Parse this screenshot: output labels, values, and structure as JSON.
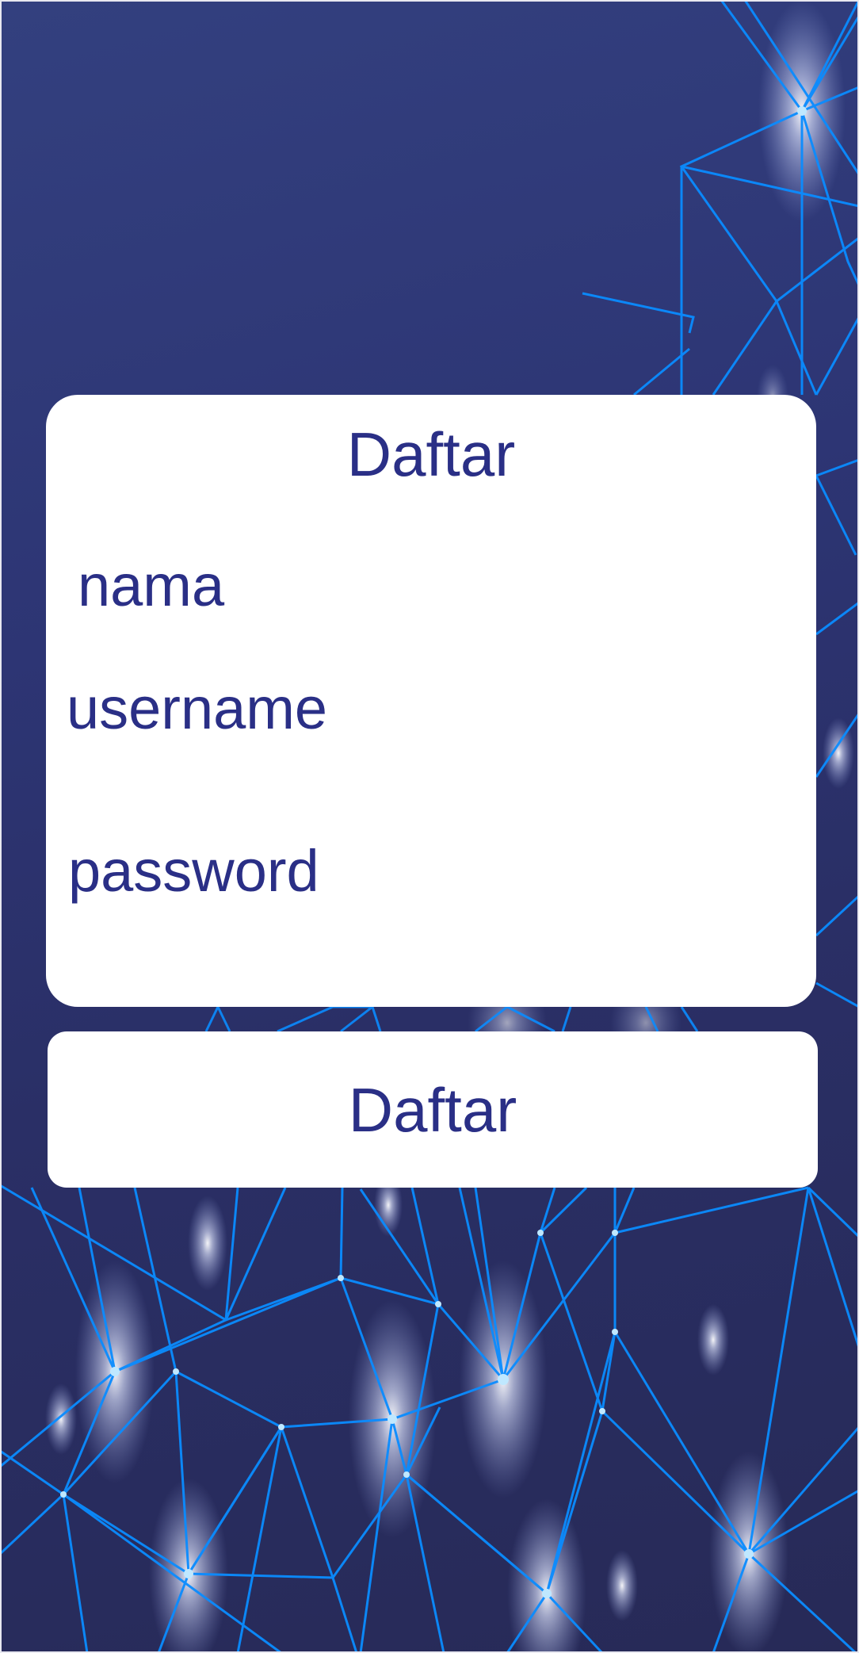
{
  "form": {
    "title": "Daftar",
    "fields": {
      "nama": {
        "label": "nama",
        "value": ""
      },
      "username": {
        "label": "username",
        "value": ""
      },
      "password": {
        "label": "password",
        "value": ""
      }
    },
    "submit_label": "Daftar"
  },
  "theme": {
    "background": "#2d3574",
    "network_line": "#0a8cff",
    "card": "#ffffff",
    "text": "#2a2f86"
  }
}
